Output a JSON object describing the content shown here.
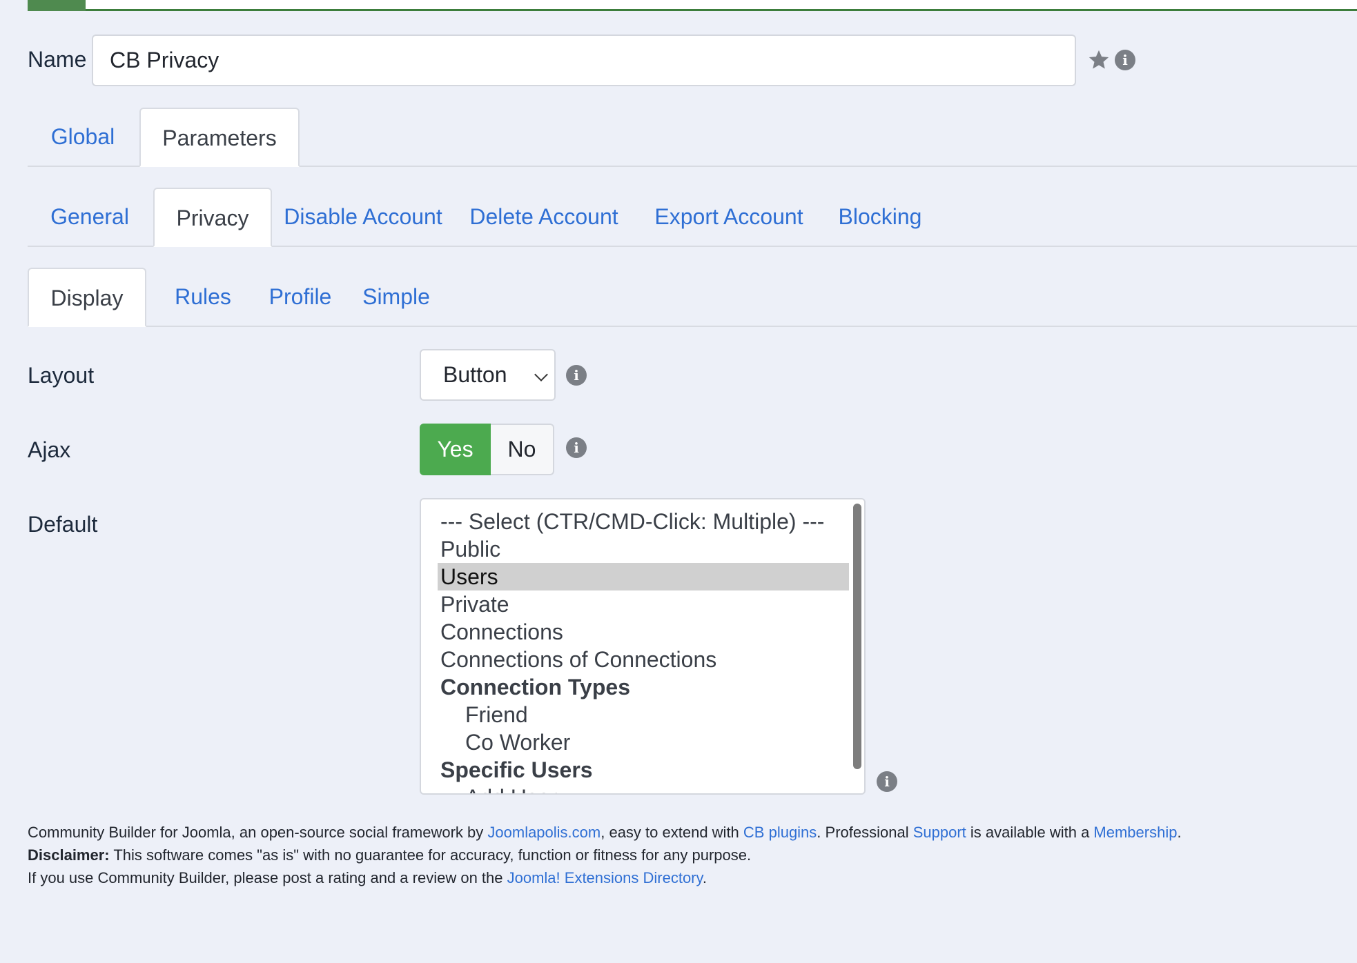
{
  "name_field": {
    "label": "Name",
    "value": "CB Privacy"
  },
  "main_tabs": [
    {
      "label": "Global"
    },
    {
      "label": "Parameters"
    }
  ],
  "sub_tabs": [
    {
      "label": "General"
    },
    {
      "label": "Privacy"
    },
    {
      "label": "Disable Account"
    },
    {
      "label": "Delete Account"
    },
    {
      "label": "Export Account"
    },
    {
      "label": "Blocking"
    }
  ],
  "display_tabs": [
    {
      "label": "Display"
    },
    {
      "label": "Rules"
    },
    {
      "label": "Profile"
    },
    {
      "label": "Simple"
    }
  ],
  "layout": {
    "label": "Layout",
    "value": "Button"
  },
  "ajax": {
    "label": "Ajax",
    "yes": "Yes",
    "no": "No",
    "selected": "Yes"
  },
  "default": {
    "label": "Default",
    "options": [
      "--- Select (CTR/CMD-Click: Multiple) ---",
      "Public",
      "Users",
      "Private",
      "Connections",
      "Connections of Connections",
      "Connection Types",
      "Friend",
      "Co Worker",
      "Specific Users",
      "Add User"
    ],
    "selected": "Users"
  },
  "footer": {
    "line1_a": "Community Builder for Joomla, an open-source social framework by ",
    "link_joomlapolis": "Joomlapolis.com",
    "line1_b": ", easy to extend with ",
    "link_cb_plugins": "CB plugins",
    "line1_c": ". Professional ",
    "link_support": "Support",
    "line1_d": " is available with a ",
    "link_membership": "Membership",
    "line1_e": ".",
    "disclaimer_label": "Disclaimer:",
    "disclaimer_text": " This software comes \"as is\" with no guarantee for accuracy, function or fitness for any purpose.",
    "line3_a": "If you use Community Builder, please post a rating and a review on the ",
    "link_jed": "Joomla! Extensions Directory",
    "line3_b": "."
  },
  "colors": {
    "accent": "#2f6fd4",
    "toggle_on": "#4caa4f",
    "background": "#edf0f8"
  },
  "icons": {
    "favorite": "star-icon",
    "info": "info-icon"
  }
}
